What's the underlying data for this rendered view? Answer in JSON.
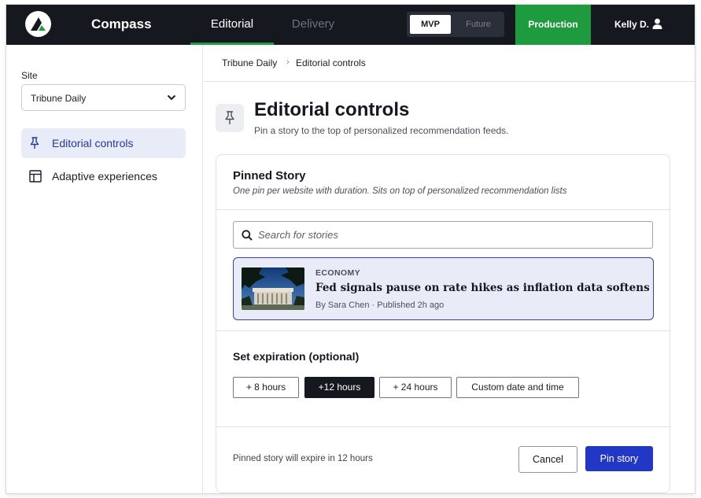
{
  "colors": {
    "topbar_bg": "#15181f",
    "production_green": "#1f9b3f",
    "accent_blue": "#2237c6",
    "selected_bg": "#e8ecf8"
  },
  "topbar": {
    "logo_icon": "compass-logo",
    "brand": "Compass",
    "tabs": [
      {
        "label": "Editorial",
        "active": true
      },
      {
        "label": "Delivery",
        "active": false
      }
    ],
    "env_toggle": {
      "options": [
        "MVP",
        "Future"
      ],
      "selected": "MVP"
    },
    "production_label": "Production",
    "user": {
      "name": "Kelly D.",
      "icon": "user-icon"
    }
  },
  "sidebar": {
    "site_label": "Site",
    "site_value": "Tribune Daily",
    "items": [
      {
        "label": "Editorial controls",
        "icon": "pin-icon",
        "active": true
      },
      {
        "label": "Adaptive experiences",
        "icon": "layout-icon",
        "active": false
      }
    ]
  },
  "breadcrumb": {
    "items": [
      "Tribune Daily",
      "Editorial controls"
    ],
    "separator": "›"
  },
  "page": {
    "icon": "pin-icon",
    "title": "Editorial controls",
    "subtitle": "Pin a story to the top of personalized recommendation feeds."
  },
  "card": {
    "title": "Pinned Story",
    "description": "One pin per website with duration. Sits on top of personalized recommendation lists",
    "search": {
      "placeholder": "Search for stories",
      "value": ""
    },
    "story": {
      "category": "ECONOMY",
      "headline": "Fed signals pause on rate hikes as inflation data softens",
      "byline": "By Sara Chen · Published 2h ago"
    },
    "expiration": {
      "title": "Set expiration (optional)",
      "options": [
        "+ 8 hours",
        "+12 hours",
        "+ 24 hours",
        "Custom date and time"
      ],
      "selected": "+12 hours"
    },
    "footer": {
      "note": "Pinned story will expire in 12 hours",
      "cancel": "Cancel",
      "pin": "Pin story"
    }
  }
}
